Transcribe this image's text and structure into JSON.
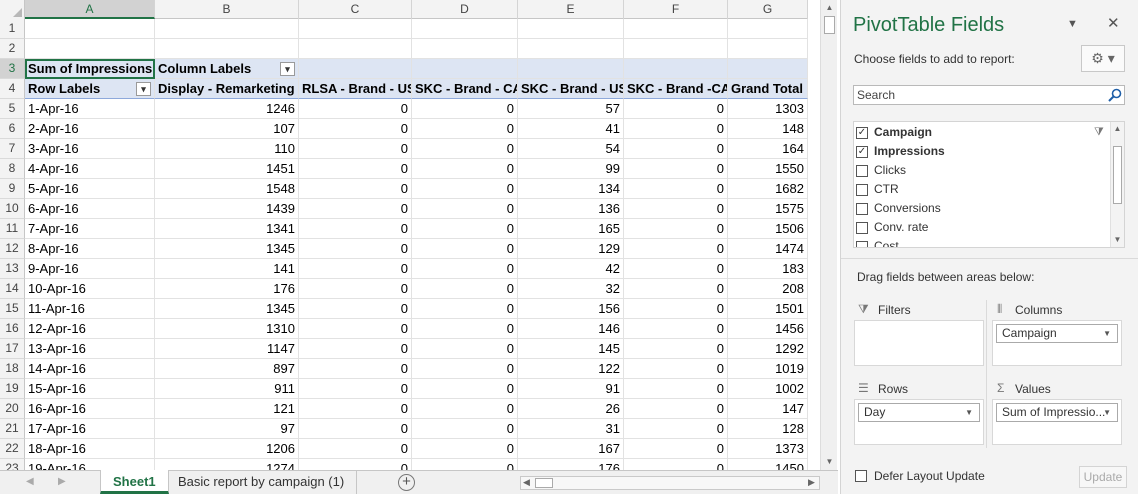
{
  "columns": [
    "A",
    "B",
    "C",
    "D",
    "E",
    "F",
    "G"
  ],
  "row_numbers": [
    "1",
    "2",
    "3",
    "4",
    "5",
    "6",
    "7",
    "8",
    "9",
    "10",
    "11",
    "12",
    "13",
    "14",
    "15",
    "16",
    "17",
    "18",
    "19",
    "20",
    "21",
    "22",
    "23"
  ],
  "pivot": {
    "value_label": "Sum of Impressions",
    "column_labels": "Column Labels",
    "row_labels": "Row Labels",
    "headers": [
      "Display - Remarketing",
      "RLSA - Brand - US",
      "SKC - Brand - CA",
      "SKC - Brand - US",
      "SKC - Brand -CA",
      "Grand Total"
    ],
    "rows": [
      [
        "1-Apr-16",
        "1246",
        "0",
        "0",
        "57",
        "0",
        "1303"
      ],
      [
        "2-Apr-16",
        "107",
        "0",
        "0",
        "41",
        "0",
        "148"
      ],
      [
        "3-Apr-16",
        "110",
        "0",
        "0",
        "54",
        "0",
        "164"
      ],
      [
        "4-Apr-16",
        "1451",
        "0",
        "0",
        "99",
        "0",
        "1550"
      ],
      [
        "5-Apr-16",
        "1548",
        "0",
        "0",
        "134",
        "0",
        "1682"
      ],
      [
        "6-Apr-16",
        "1439",
        "0",
        "0",
        "136",
        "0",
        "1575"
      ],
      [
        "7-Apr-16",
        "1341",
        "0",
        "0",
        "165",
        "0",
        "1506"
      ],
      [
        "8-Apr-16",
        "1345",
        "0",
        "0",
        "129",
        "0",
        "1474"
      ],
      [
        "9-Apr-16",
        "141",
        "0",
        "0",
        "42",
        "0",
        "183"
      ],
      [
        "10-Apr-16",
        "176",
        "0",
        "0",
        "32",
        "0",
        "208"
      ],
      [
        "11-Apr-16",
        "1345",
        "0",
        "0",
        "156",
        "0",
        "1501"
      ],
      [
        "12-Apr-16",
        "1310",
        "0",
        "0",
        "146",
        "0",
        "1456"
      ],
      [
        "13-Apr-16",
        "1147",
        "0",
        "0",
        "145",
        "0",
        "1292"
      ],
      [
        "14-Apr-16",
        "897",
        "0",
        "0",
        "122",
        "0",
        "1019"
      ],
      [
        "15-Apr-16",
        "911",
        "0",
        "0",
        "91",
        "0",
        "1002"
      ],
      [
        "16-Apr-16",
        "121",
        "0",
        "0",
        "26",
        "0",
        "147"
      ],
      [
        "17-Apr-16",
        "97",
        "0",
        "0",
        "31",
        "0",
        "128"
      ],
      [
        "18-Apr-16",
        "1206",
        "0",
        "0",
        "167",
        "0",
        "1373"
      ],
      [
        "19-Apr-16",
        "1274",
        "0",
        "0",
        "176",
        "0",
        "1450"
      ]
    ]
  },
  "sheet_tabs": [
    "Sheet1",
    "Basic report by campaign (1)"
  ],
  "active_tab": "Sheet1",
  "pane": {
    "title": "PivotTable Fields",
    "choose_label": "Choose fields to add to report:",
    "search_placeholder": "Search",
    "fields": [
      {
        "label": "Campaign",
        "checked": true,
        "bold": true,
        "filtered": true
      },
      {
        "label": "Impressions",
        "checked": true,
        "bold": true,
        "filtered": false
      },
      {
        "label": "Clicks",
        "checked": false,
        "bold": false,
        "filtered": false
      },
      {
        "label": "CTR",
        "checked": false,
        "bold": false,
        "filtered": false
      },
      {
        "label": "Conversions",
        "checked": false,
        "bold": false,
        "filtered": false
      },
      {
        "label": "Conv. rate",
        "checked": false,
        "bold": false,
        "filtered": false
      },
      {
        "label": "Cost",
        "checked": false,
        "bold": false,
        "filtered": false
      }
    ],
    "drag_label": "Drag fields between areas below:",
    "areas": {
      "filters": {
        "title": "Filters",
        "items": []
      },
      "columns": {
        "title": "Columns",
        "items": [
          "Campaign"
        ]
      },
      "rows": {
        "title": "Rows",
        "items": [
          "Day"
        ]
      },
      "values": {
        "title": "Values",
        "items": [
          "Sum of Impressio..."
        ]
      }
    },
    "defer_label": "Defer Layout Update",
    "update_label": "Update"
  },
  "colors": {
    "accent": "#217346",
    "pivot_header_bg": "#dde5f3",
    "pane_bg": "#f3f3f3"
  }
}
